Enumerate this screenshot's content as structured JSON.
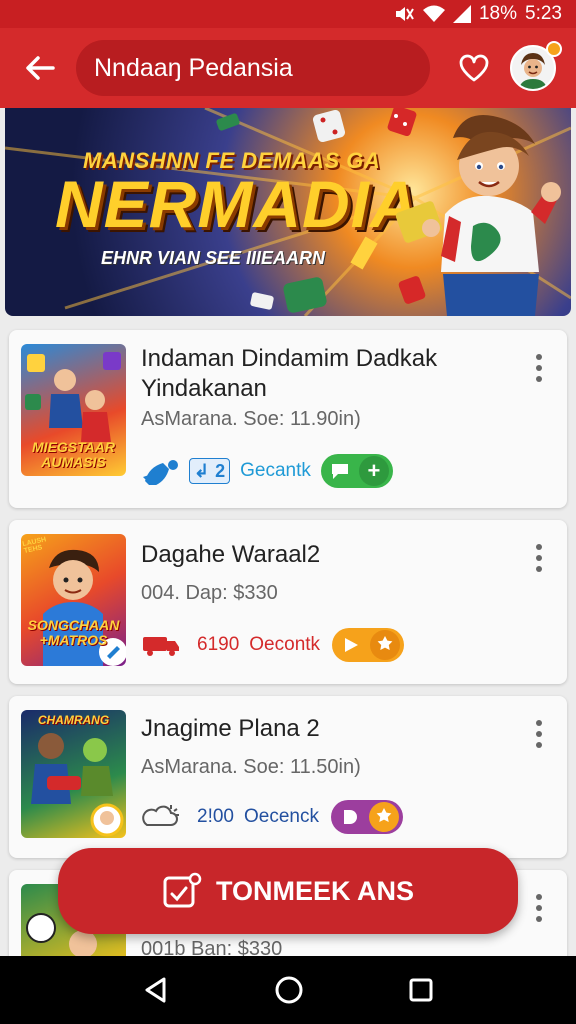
{
  "status_bar": {
    "battery": "18%",
    "time": "5:23"
  },
  "header": {
    "title": "Nndaaŋ Pedansia"
  },
  "banner": {
    "subtitle": "MANSHNN FE DEMAAS GA",
    "title": "NERMADIA",
    "tagline": "EHNR VIAN SEE IIIEAARN"
  },
  "list": [
    {
      "title": "Indaman Dindamim Dadkak Yindakanan",
      "meta": "AsMarana. Soe: 11.90in)",
      "thumb_text": "MIEGSTAAR AUMASIS",
      "badge": "2",
      "status": "Gecantk"
    },
    {
      "title": "Dagahe Waraal2",
      "meta": "004. Dap: $330",
      "thumb_text": "SONGCHAAN +MATROS",
      "thumb_corner": "LAUSH TEHS",
      "count": "6190",
      "status": "Oecontk"
    },
    {
      "title": "Jnagime Plana 2",
      "meta": "AsMarana. Soe: 11.50in)",
      "thumb_text": "CHAMRANG",
      "count": "2!00",
      "status": "Oecenck"
    },
    {
      "meta": "001b Ban: $330"
    }
  ],
  "fab": {
    "label": "TONMEEK ANS"
  },
  "colors": {
    "primary": "#d42a2b",
    "primary_dark": "#c81f22",
    "accent_green": "#39b54a",
    "accent_orange": "#f6a21b",
    "accent_purple": "#9c3e9e",
    "link_blue": "#1f7fd0"
  }
}
